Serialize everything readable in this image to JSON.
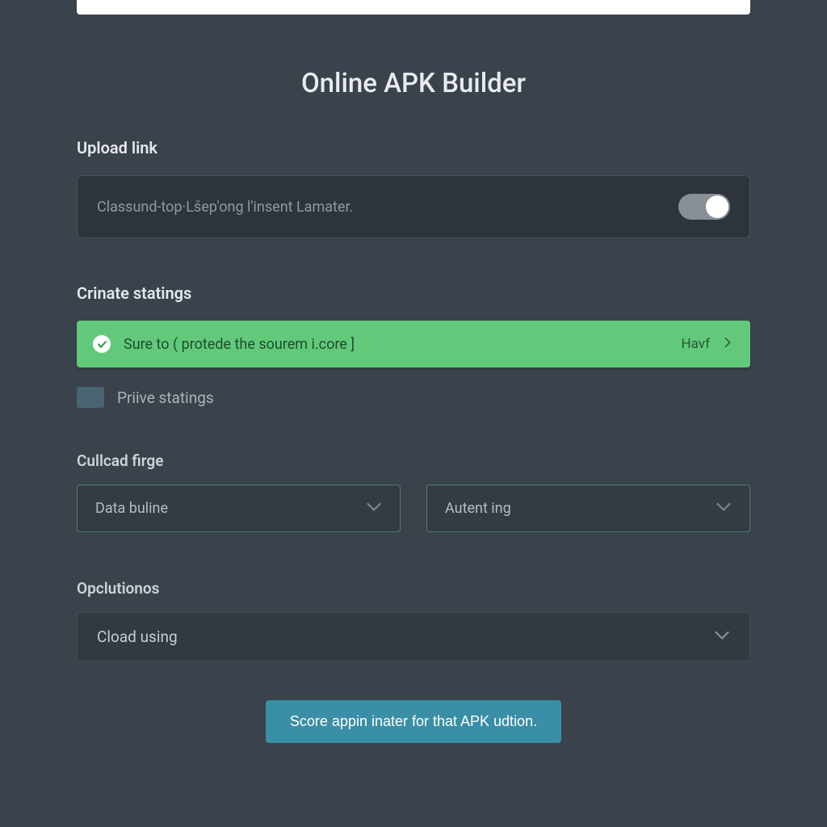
{
  "title": "Online APK Builder",
  "upload": {
    "heading": "Upload link",
    "placeholder": "Classund-top·Lšep'ong l'insent Lamater.",
    "toggle_on": true
  },
  "settings": {
    "heading": "Crinate statings",
    "protect_label": "Sure to ( protede the sourem i.core ]",
    "protect_right": "Havf",
    "private_label": "Priive statings"
  },
  "cullcad": {
    "heading": "Cullcad firge",
    "select1": "Data buline",
    "select2": "Autent ing"
  },
  "options": {
    "heading": "Opclutionos",
    "select": "Cload using"
  },
  "submit_label": "Score appin inater for that APK udtion."
}
